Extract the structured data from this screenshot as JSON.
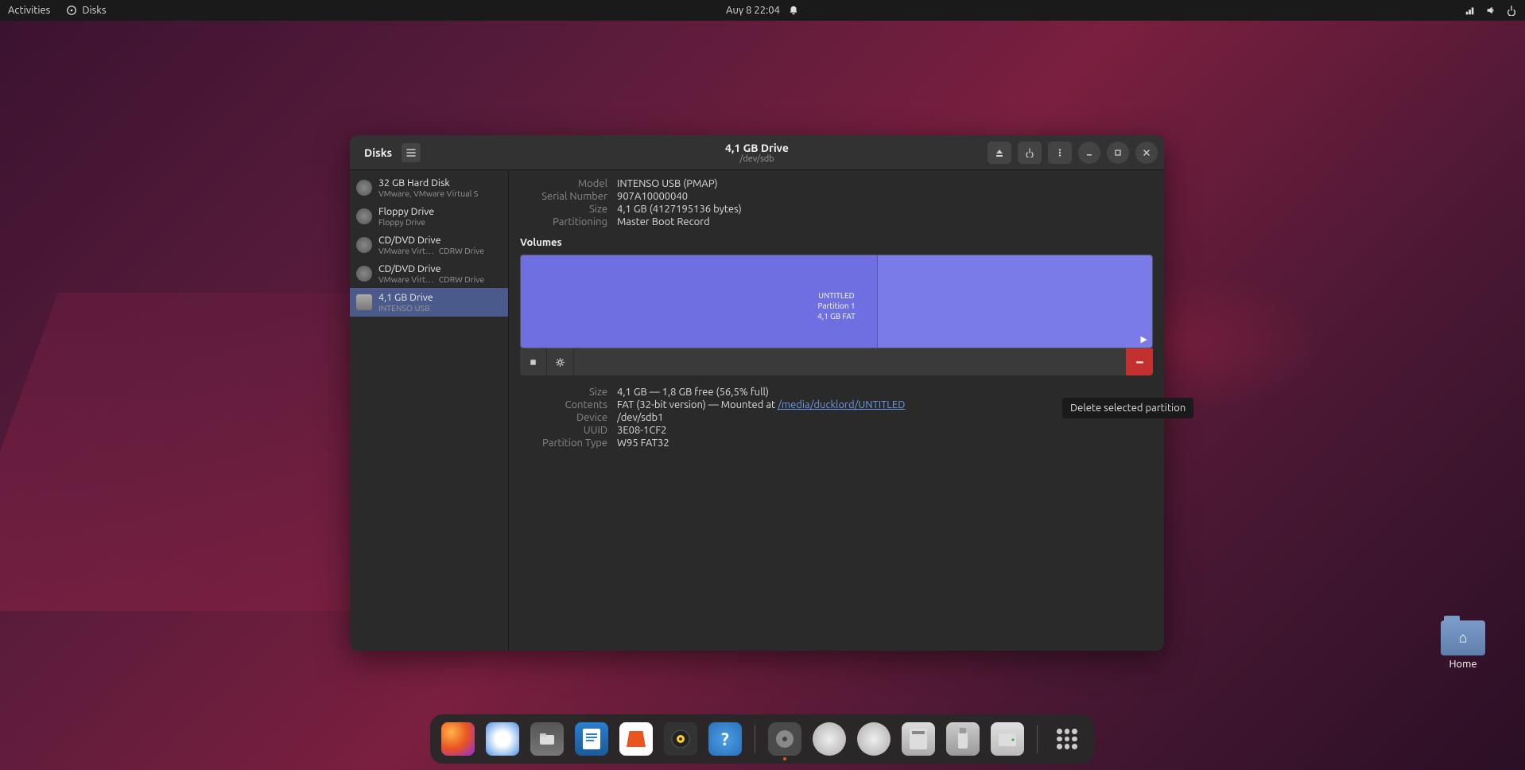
{
  "topbar": {
    "activities": "Activities",
    "app_name": "Disks",
    "datetime": "Αυγ 8  22:04"
  },
  "desktop": {
    "home_label": "Home"
  },
  "window": {
    "title_app": "Disks",
    "title_drive": "4,1 GB Drive",
    "title_device": "/dev/sdb"
  },
  "sidebar": {
    "drives": [
      {
        "name": "32 GB Hard Disk",
        "sub": "VMware, VMware Virtual S",
        "badge": ""
      },
      {
        "name": "Floppy Drive",
        "sub": "Floppy Drive",
        "badge": ""
      },
      {
        "name": "CD/DVD Drive",
        "sub": "VMware Virt…",
        "badge": "CDRW Drive"
      },
      {
        "name": "CD/DVD Drive",
        "sub": "VMware Virt…",
        "badge": "CDRW Drive"
      },
      {
        "name": "4,1 GB Drive",
        "sub": "INTENSO USB",
        "badge": ""
      }
    ]
  },
  "info": {
    "model_label": "Model",
    "model": "INTENSO USB (PMAP)",
    "serial_label": "Serial Number",
    "serial": "907A10000040",
    "size_label": "Size",
    "size": "4,1 GB (4127195136 bytes)",
    "partitioning_label": "Partitioning",
    "partitioning": "Master Boot Record"
  },
  "volumes": {
    "heading": "Volumes",
    "name": "UNTITLED",
    "partition": "Partition 1",
    "fs": "4,1 GB FAT"
  },
  "details": {
    "size_label": "Size",
    "size": "4,1 GB — 1,8 GB free (56,5% full)",
    "contents_label": "Contents",
    "contents_prefix": "FAT (32-bit version) — Mounted at ",
    "contents_link": "/media/ducklord/UNTITLED",
    "device_label": "Device",
    "device": "/dev/sdb1",
    "uuid_label": "UUID",
    "uuid": "3E08-1CF2",
    "ptype_label": "Partition Type",
    "ptype": "W95 FAT32"
  },
  "tooltip": "Delete selected partition",
  "dock": {
    "items": [
      "firefox",
      "thunderbird",
      "files",
      "libreoffice",
      "software",
      "rhythmbox",
      "help",
      "disks",
      "drive1",
      "drive2",
      "sdcard",
      "usb",
      "optical",
      "apps"
    ]
  }
}
